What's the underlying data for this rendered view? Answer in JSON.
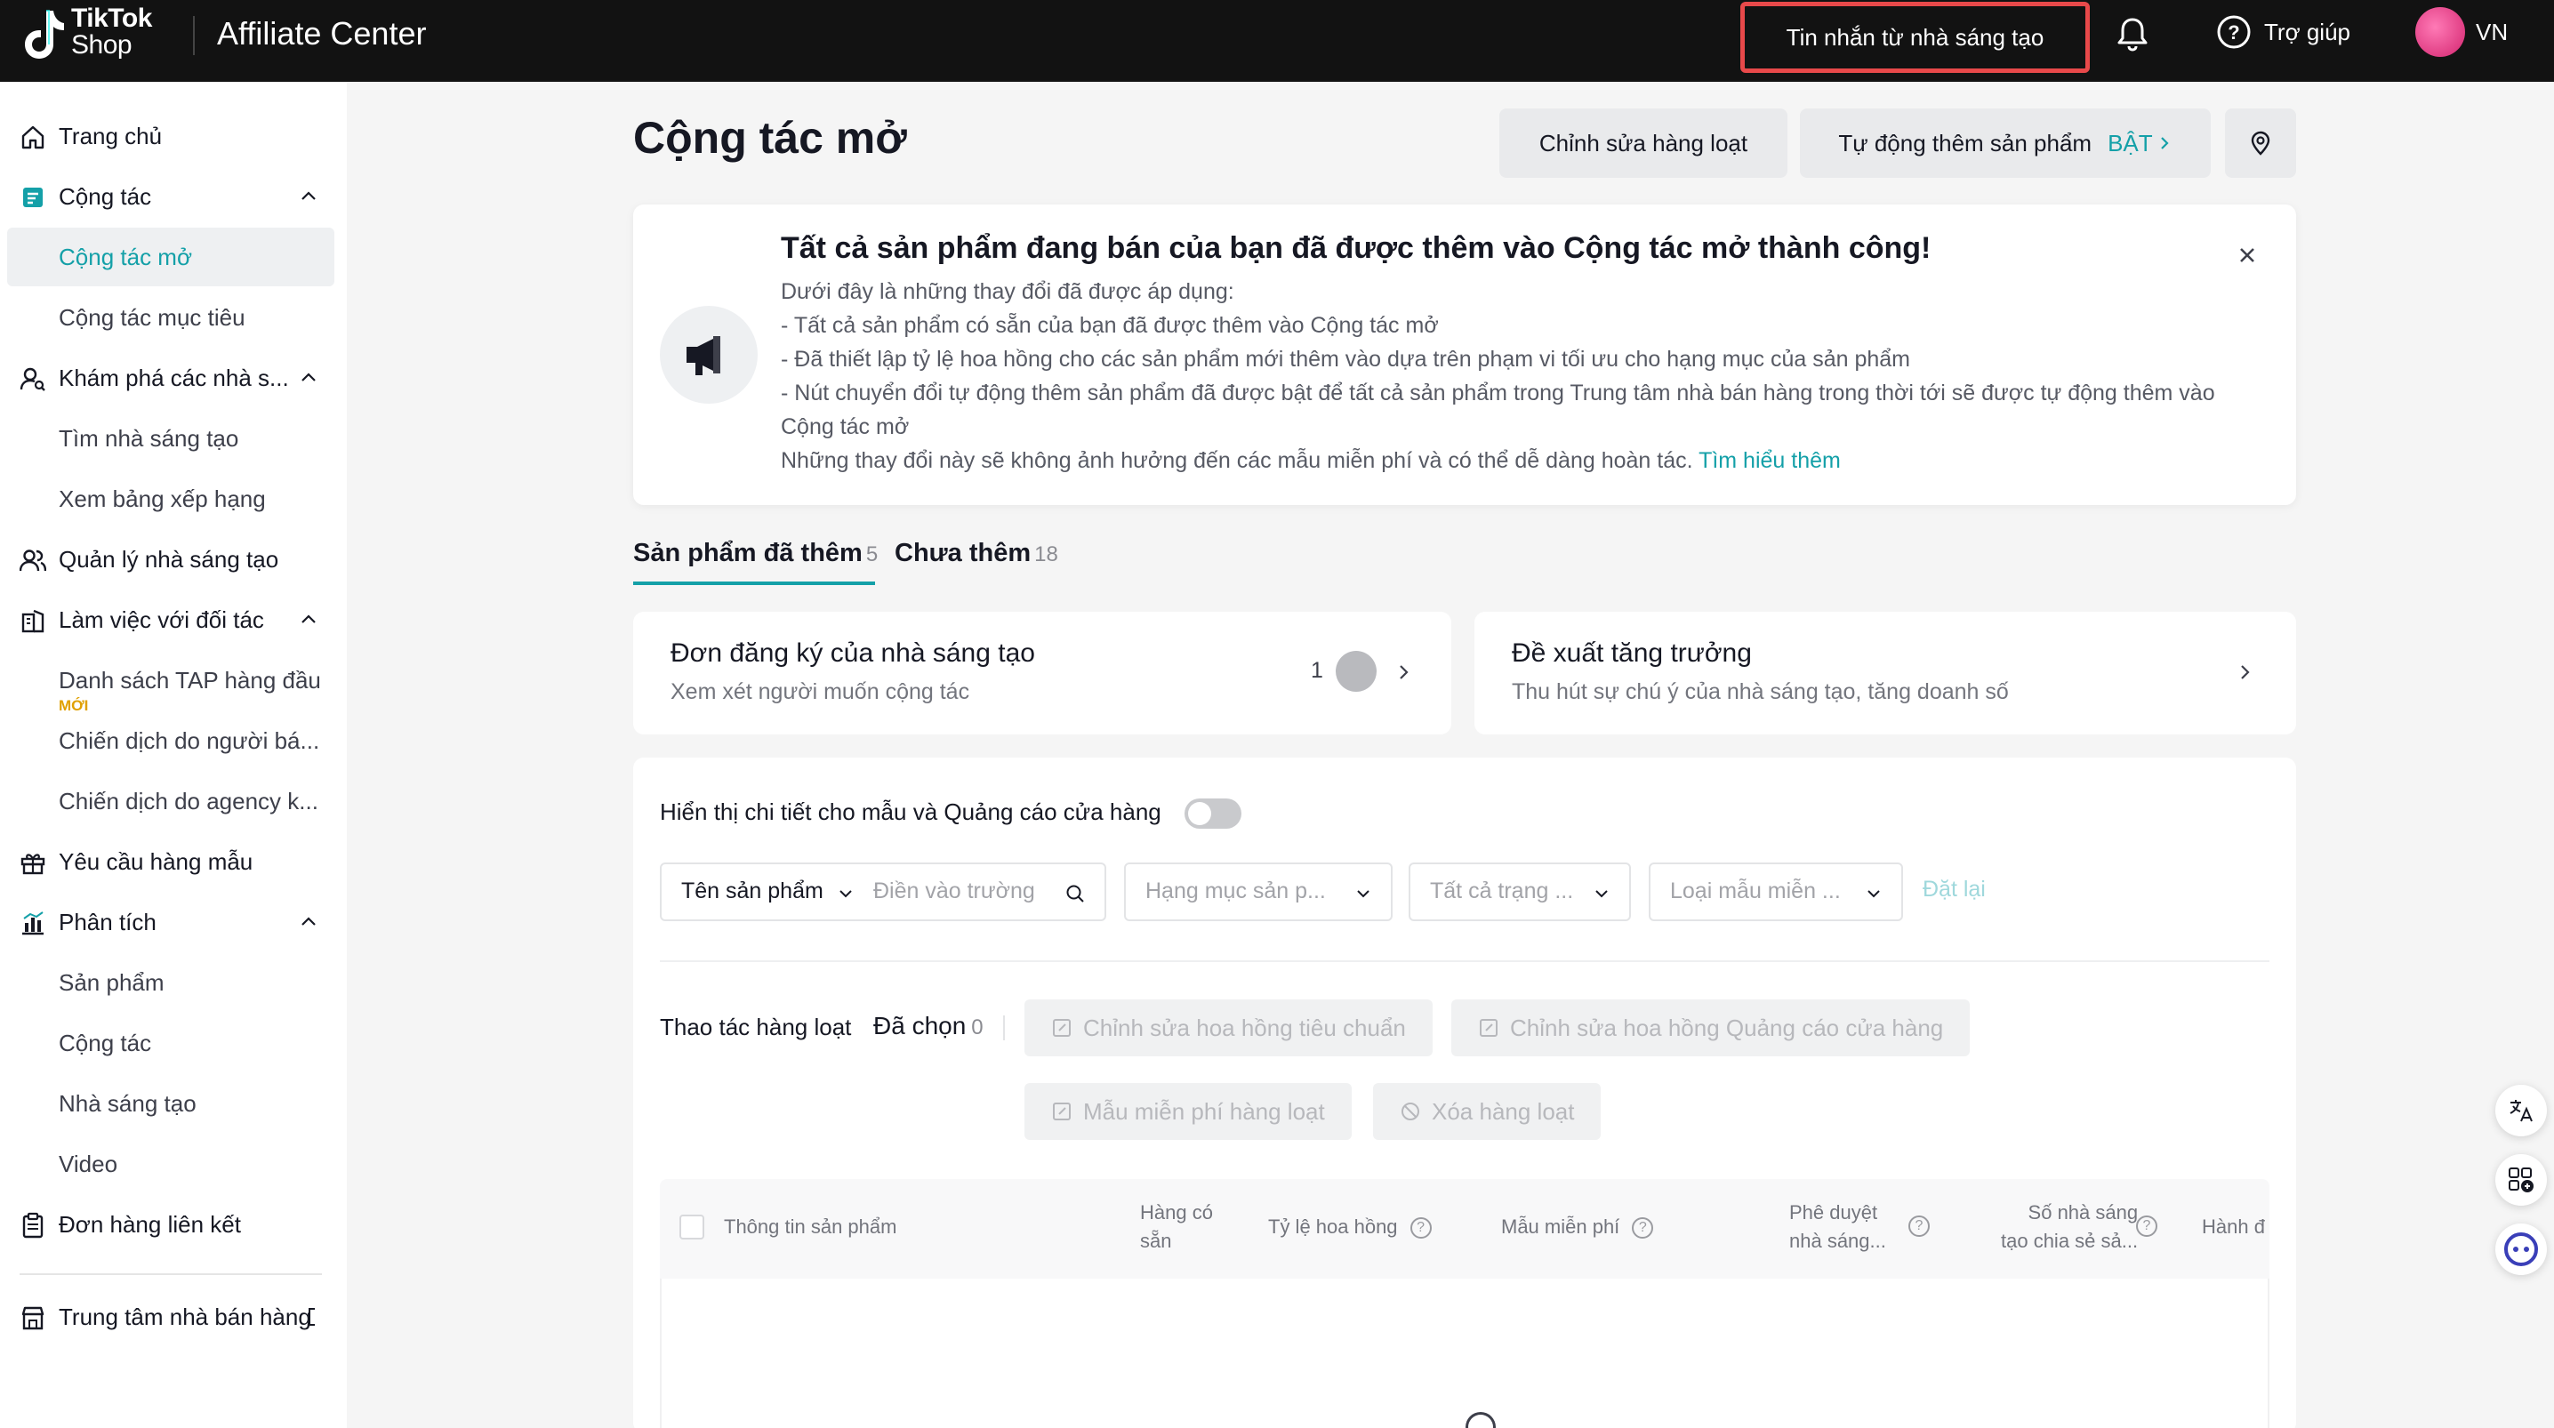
{
  "header": {
    "logo_line1": "TikTok",
    "logo_line2": "Shop",
    "app_title": "Affiliate Center",
    "creator_messages": "Tin nhắn từ nhà sáng tạo",
    "help": "Trợ giúp",
    "region": "VN"
  },
  "sidebar": {
    "items": [
      {
        "label": "Trang chủ"
      },
      {
        "label": "Cộng tác"
      },
      {
        "label": "Cộng tác mở"
      },
      {
        "label": "Cộng tác mục tiêu"
      },
      {
        "label": "Khám phá các nhà s..."
      },
      {
        "label": "Tìm nhà sáng tạo"
      },
      {
        "label": "Xem bảng xếp hạng"
      },
      {
        "label": "Quản lý nhà sáng tạo"
      },
      {
        "label": "Làm việc với đối tác"
      },
      {
        "label": "Danh sách TAP hàng đầu",
        "badge": "MỚI"
      },
      {
        "label": "Chiến dịch do người bá..."
      },
      {
        "label": "Chiến dịch do agency k..."
      },
      {
        "label": "Yêu cầu hàng mẫu"
      },
      {
        "label": "Phân tích"
      },
      {
        "label": "Sản phẩm"
      },
      {
        "label": "Cộng tác"
      },
      {
        "label": "Nhà sáng tạo"
      },
      {
        "label": "Video"
      },
      {
        "label": "Đơn hàng liên kết"
      },
      {
        "label": "Trung tâm nhà bán hàng"
      }
    ]
  },
  "page": {
    "title": "Cộng tác mở",
    "bulk_edit": "Chỉnh sửa hàng loạt",
    "auto_add": "Tự động thêm sản phẩm",
    "auto_add_state": "BẬT"
  },
  "banner": {
    "title": "Tất cả sản phẩm đang bán của bạn đã được thêm vào Cộng tác mở thành công!",
    "lines": [
      "Dưới đây là những thay đổi đã được áp dụng:",
      "- Tất cả sản phẩm có sẵn của bạn đã được thêm vào Cộng tác mở",
      "- Đã thiết lập tỷ lệ hoa hồng cho các sản phẩm mới thêm vào dựa trên phạm vi tối ưu cho hạng mục của sản phẩm",
      "- Nút chuyển đổi tự động thêm sản phẩm đã được bật để tất cả sản phẩm trong Trung tâm nhà bán hàng trong thời tới sẽ được tự động thêm vào",
      "Cộng tác mở",
      "Những thay đổi này sẽ không ảnh hưởng đến các mẫu miễn phí và có thể dễ dàng hoàn tác."
    ],
    "learn_more": "Tìm hiểu thêm"
  },
  "tabs": [
    {
      "label": "Sản phẩm đã thêm",
      "count": "5"
    },
    {
      "label": "Chưa thêm",
      "count": "18"
    }
  ],
  "cards": {
    "applications": {
      "title": "Đơn đăng ký của nhà sáng tạo",
      "subtitle": "Xem xét người muốn cộng tác",
      "count": "1"
    },
    "growth": {
      "title": "Đề xuất tăng trưởng",
      "subtitle": "Thu hút sự chú ý của nhà sáng tạo, tăng doanh số"
    }
  },
  "filters": {
    "toggle_label": "Hiển thị chi tiết cho mẫu và Quảng cáo cửa hàng",
    "field_select": "Tên sản phẩm",
    "search_placeholder": "Điền vào trường",
    "category_placeholder": "Hạng mục sản p...",
    "status_placeholder": "Tất cả trạng ...",
    "sample_placeholder": "Loại mẫu miễn ...",
    "reset": "Đặt lại"
  },
  "bulk": {
    "label": "Thao tác hàng loạt",
    "selected_label": "Đã chọn",
    "selected_count": "0",
    "edit_standard": "Chỉnh sửa hoa hồng tiêu chuẩn",
    "edit_ads": "Chỉnh sửa hoa hồng Quảng cáo cửa hàng",
    "free_samples": "Mẫu miễn phí hàng loạt",
    "delete": "Xóa hàng loạt"
  },
  "table": {
    "headers": {
      "product_info": "Thông tin sản phẩm",
      "stock_l1": "Hàng có",
      "stock_l2": "sẵn",
      "commission": "Tỷ lệ hoa hồng",
      "free_sample": "Mẫu miễn phí",
      "approve_l1": "Phê duyệt",
      "approve_l2": "nhà sáng...",
      "sharers_l1": "Số nhà sáng",
      "sharers_l2": "tạo chia sẻ sả...",
      "action": "Hành đ"
    }
  },
  "colors": {
    "accent": "#14a0a8",
    "topbar": "#121212",
    "highlight_border": "#e8494a"
  }
}
